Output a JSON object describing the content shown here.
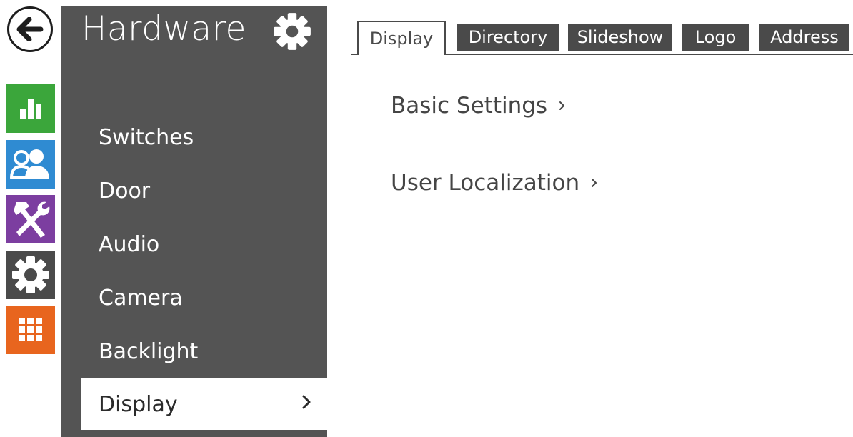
{
  "rail": {
    "back_icon": "arrow-left-icon",
    "items": [
      {
        "name": "status",
        "icon": "bar-chart-icon",
        "color": "#3ba63b"
      },
      {
        "name": "directory",
        "icon": "users-icon",
        "color": "#2f8bd2"
      },
      {
        "name": "hardware",
        "icon": "tools-icon",
        "color": "#7c3ea0"
      },
      {
        "name": "system",
        "icon": "gear-icon",
        "color": "#4a4a4a"
      },
      {
        "name": "services",
        "icon": "grid-icon",
        "color": "#e8651e"
      }
    ]
  },
  "sidebar": {
    "title": "Hardware",
    "settings_icon": "gear-icon",
    "items": [
      {
        "label": "Switches"
      },
      {
        "label": "Door"
      },
      {
        "label": "Audio"
      },
      {
        "label": "Camera"
      },
      {
        "label": "Backlight"
      },
      {
        "label": "Display",
        "active": true
      }
    ],
    "background": "#545454"
  },
  "tabs": [
    {
      "label": "Display",
      "active": true
    },
    {
      "label": "Directory"
    },
    {
      "label": "Slideshow"
    },
    {
      "label": "Logo"
    },
    {
      "label": "Address"
    }
  ],
  "main": {
    "sections": [
      {
        "label": "Basic Settings"
      },
      {
        "label": "User Localization"
      }
    ]
  }
}
